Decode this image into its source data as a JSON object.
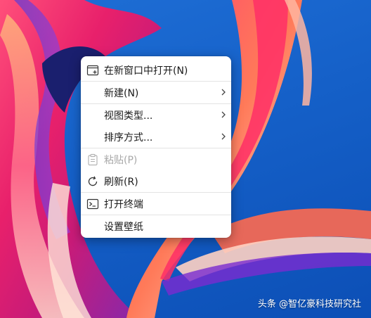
{
  "menu": {
    "open_new_window": "在新窗口中打开(N)",
    "new": "新建(N)",
    "view_type": "视图类型...",
    "sort_by": "排序方式...",
    "paste": "粘贴(P)",
    "refresh": "刷新(R)",
    "open_terminal": "打开终端",
    "set_wallpaper": "设置壁纸"
  },
  "icons": {
    "open_new_window": "new-window-icon",
    "paste": "clipboard-icon",
    "refresh": "refresh-icon",
    "open_terminal": "terminal-icon",
    "submenu": "chevron-right-icon"
  },
  "watermark": "头条 @智亿豪科技研究社",
  "colors": {
    "desktop_blue": "#1560c8",
    "menu_bg": "#ffffff",
    "text": "#1a1a1a",
    "disabled_text": "#a8a8a8"
  }
}
